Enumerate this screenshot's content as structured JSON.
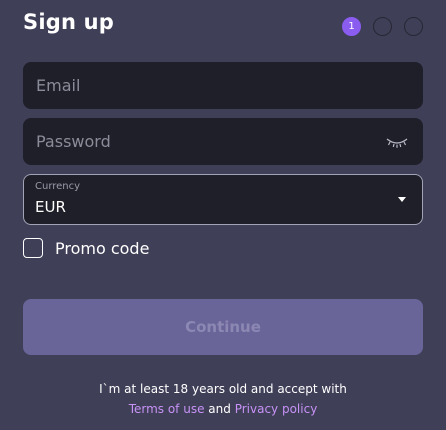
{
  "header": {
    "title": "Sign up",
    "steps": [
      "1",
      "",
      ""
    ]
  },
  "form": {
    "email_placeholder": "Email",
    "email_value": "",
    "password_placeholder": "Password",
    "password_value": "",
    "currency_label": "Currency",
    "currency_value": "EUR",
    "promo_label": "Promo code",
    "promo_checked": false,
    "continue_label": "Continue"
  },
  "legal": {
    "text_before": "I`m at least 18 years old and accept with",
    "terms_link": "Terms of use",
    "and_text": "and",
    "privacy_link": "Privacy policy"
  },
  "icons": {
    "password_toggle": "eye-closed-icon",
    "currency_dropdown": "caret-down-icon"
  },
  "colors": {
    "background": "#3f3f58",
    "field": "#1e1f28",
    "accent": "#8a5cf0",
    "button": "#6a6599",
    "link": "#c792f5"
  }
}
